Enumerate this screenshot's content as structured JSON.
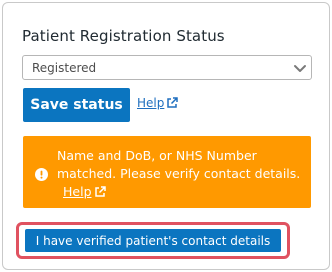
{
  "form": {
    "title": "Patient Registration Status",
    "status_select": {
      "value": "Registered"
    },
    "save_label": "Save status",
    "help_label": "Help"
  },
  "alert": {
    "message": "Name and DoB, or NHS Number matched. Please verify contact details.",
    "help_label": "Help"
  },
  "verify": {
    "label": "I have verified patient's contact details"
  },
  "colors": {
    "primary": "#0b75c0",
    "warning": "#ff9900",
    "highlight": "#e05260",
    "link": "#1f6fbf"
  }
}
